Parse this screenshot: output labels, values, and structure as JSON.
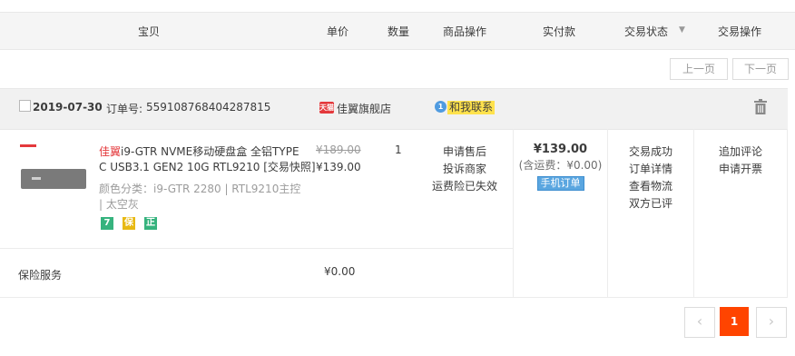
{
  "header": {
    "col_item": "宝贝",
    "col_price": "单价",
    "col_qty": "数量",
    "col_ops": "商品操作",
    "col_paid": "实付款",
    "col_status": "交易状态",
    "col_status_arrow": "▼",
    "col_trade_ops": "交易操作"
  },
  "pager_top": {
    "prev": "上一页",
    "next": "下一页"
  },
  "order": {
    "date": "2019-07-30",
    "order_no_label": "订单号:",
    "order_no": "559108768404287815",
    "shop_badge": "天猫",
    "shop_name": "佳翼旗舰店",
    "contact_label": "和我联系",
    "contact_count": "1",
    "product": {
      "brand": "佳翼",
      "title_rest": "i9-GTR NVME移动硬盘盒 全铝TYPE C USB3.1 GEN2 10G RTL9210 [交易快照]",
      "title_line1_rest": "i9-GTR NVME移动硬盘盒 全铝TYPE",
      "title_line2": "C USB3.1 GEN2 10G RTL9210 [交易快照]",
      "sku_line1": "颜色分类：i9-GTR 2280 | RTL9210主控",
      "sku_line2": "| 太空灰",
      "badges": [
        "7",
        "保",
        "正"
      ],
      "original_price": "¥189.00",
      "price": "¥139.00",
      "qty": "1",
      "ops": [
        "申请售后",
        "投诉商家",
        "运费险已失效"
      ]
    },
    "payment": {
      "total": "¥139.00",
      "shipping_note": "(含运费：¥0.00)",
      "mobile_badge": "手机订单"
    },
    "status": [
      "交易成功",
      "订单详情",
      "查看物流",
      "双方已评"
    ],
    "trade_ops": [
      "追加评论",
      "申请开票"
    ],
    "insurance_label": "保险服务",
    "insurance_price": "¥0.00"
  },
  "pager_bottom": {
    "prev": "‹",
    "current": "1",
    "next": "›"
  },
  "colors": {
    "accent": "#ff4400",
    "tmall_red": "#e4393c",
    "blue_badge": "#4f9be0",
    "green": "#36b37e"
  }
}
